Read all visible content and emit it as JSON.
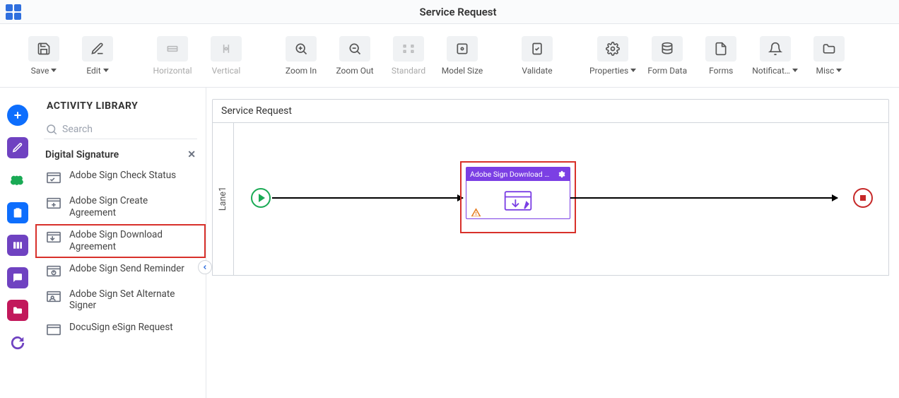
{
  "header": {
    "title": "Service Request"
  },
  "toolbar": {
    "save": "Save",
    "edit": "Edit",
    "horizontal": "Horizontal",
    "vertical": "Vertical",
    "zoom_in": "Zoom In",
    "zoom_out": "Zoom Out",
    "standard": "Standard",
    "model_size": "Model Size",
    "validate": "Validate",
    "properties": "Properties",
    "form_data": "Form Data",
    "forms": "Forms",
    "notifications": "Notificat…",
    "misc": "Misc"
  },
  "library": {
    "title": "ACTIVITY LIBRARY",
    "search_placeholder": "Search",
    "section": "Digital Signature",
    "items": [
      "Adobe Sign Check Status",
      "Adobe Sign Create Agreement",
      "Adobe Sign Download Agreement",
      "Adobe Sign Send Reminder",
      "Adobe Sign Set Alternate Signer",
      "DocuSign eSign Request"
    ]
  },
  "canvas": {
    "title": "Service Request",
    "lane_label": "Lane1",
    "task_label": "Adobe Sign Download …"
  }
}
